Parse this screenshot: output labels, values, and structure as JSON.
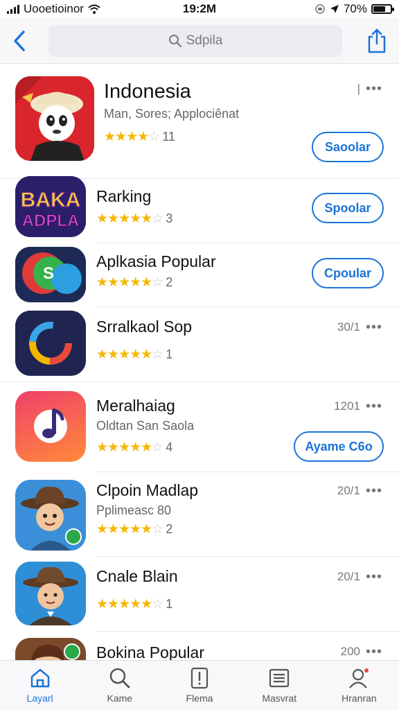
{
  "status_bar": {
    "carrier": "Uooetioinor",
    "time": "19:2M",
    "battery": "70%",
    "battery_level": 0.7
  },
  "nav": {
    "search_text": "Sdpila"
  },
  "apps": [
    {
      "name": "Indonesia",
      "subtitle": "Man, Sores; Applociênat",
      "stars": 4,
      "rating_count": "11",
      "meta": "|",
      "button": "Saoolar",
      "icon": "bird-character-icon"
    },
    {
      "name": "Rarking",
      "stars": 4.5,
      "rating_count": "3",
      "button": "Spoolar",
      "icon": "baka-text-icon",
      "icon_text_top": "BAKA",
      "icon_text_bottom": "ADPLA"
    },
    {
      "name": "Aplkasia Popular",
      "stars": 4.5,
      "rating_count": "2",
      "button": "Cpoular",
      "icon": "chat-bubbles-icon",
      "icon_text": "S"
    },
    {
      "name": "Srralkaol Sop",
      "stars": 4.5,
      "rating_count": "1",
      "meta": "30/1",
      "icon": "color-ring-icon"
    },
    {
      "name": "Meralhaiag",
      "subtitle": "Oldtan San Saola",
      "stars": 4.5,
      "rating_count": "4",
      "meta": "1201",
      "button": "Ayame C6o",
      "icon": "music-note-icon"
    },
    {
      "name": "Clpoin Madlap",
      "subtitle": "Pplimeasc 80",
      "stars": 4.5,
      "rating_count": "2",
      "meta": "20/1",
      "icon": "cowboy-character-icon"
    },
    {
      "name": "Cnale Blain",
      "stars": 4.5,
      "rating_count": "1",
      "meta": "20/1",
      "icon": "detective-character-icon"
    },
    {
      "name": "Bokina Popular",
      "meta": "200",
      "icon": "woman-character-icon"
    }
  ],
  "tabs": [
    {
      "label": "Layarl",
      "icon": "home-icon",
      "active": true
    },
    {
      "label": "Kame",
      "icon": "search-icon"
    },
    {
      "label": "Flema",
      "icon": "document-icon"
    },
    {
      "label": "Masvrat",
      "icon": "list-icon"
    },
    {
      "label": "Hranran",
      "icon": "profile-icon"
    }
  ],
  "colors": {
    "accent": "#1a73d8",
    "star": "#f5b700"
  }
}
